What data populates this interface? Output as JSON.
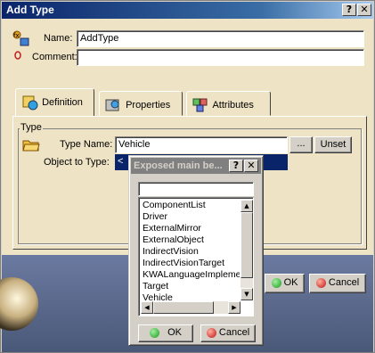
{
  "window": {
    "title": "Add Type",
    "help_btn": "?",
    "close_btn": "✕"
  },
  "form": {
    "name_label": "Name:",
    "name_value": "AddType",
    "comment_label": "Comment:",
    "comment_value": ""
  },
  "tabs": [
    {
      "label": "Definition",
      "icon": "definition-icon",
      "active": true
    },
    {
      "label": "Properties",
      "icon": "properties-icon",
      "active": false
    },
    {
      "label": "Attributes",
      "icon": "attributes-icon",
      "active": false
    }
  ],
  "type_group": {
    "legend": "Type",
    "type_name_label": "Type Name:",
    "type_name_value": "Vehicle",
    "browse_label": "...",
    "unset_label": "Unset",
    "object_to_type_label": "Object to Type:",
    "object_to_type_value": "<"
  },
  "main_buttons": {
    "ok": "OK",
    "cancel": "Cancel"
  },
  "popup": {
    "title": "Exposed main be...",
    "help_btn": "?",
    "close_btn": "✕",
    "filter_value": "",
    "items": [
      "ComponentList",
      "Driver",
      "ExternalMirror",
      "ExternalObject",
      "IndirectVision",
      "IndirectVisionTarget",
      "KWALanguageImpleme",
      "Target",
      "Vehicle"
    ],
    "ok": "OK",
    "cancel": "Cancel"
  }
}
